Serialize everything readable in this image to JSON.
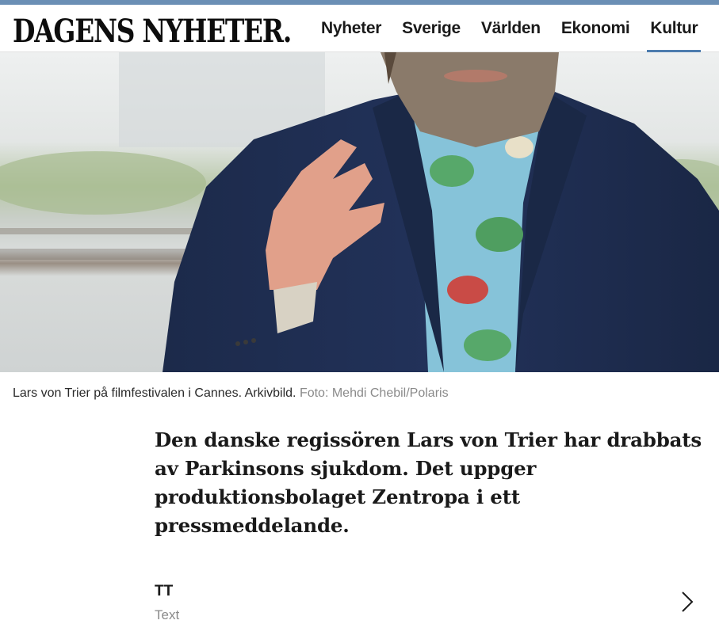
{
  "header": {
    "logo": "DAGENS NYHETER.",
    "nav": [
      {
        "label": "Nyheter",
        "active": false
      },
      {
        "label": "Sverige",
        "active": false
      },
      {
        "label": "Världen",
        "active": false
      },
      {
        "label": "Ekonomi",
        "active": false
      },
      {
        "label": "Kultur",
        "active": true
      }
    ],
    "accent_color": "#4d7cae"
  },
  "photo": {
    "caption": "Lars von Trier på filmfestivalen i Cannes. Arkivbild.",
    "credit": "Foto: Mehdi Chebil/Polaris"
  },
  "article": {
    "lede": "Den danske regissören Lars von Trier har drabbats av Parkinsons sjukdom. Det uppger produktionsbolaget Zentropa i ett pressmeddelande."
  },
  "byline": {
    "author": "TT",
    "role": "Text",
    "chevron_icon": "chevron-right-icon"
  }
}
